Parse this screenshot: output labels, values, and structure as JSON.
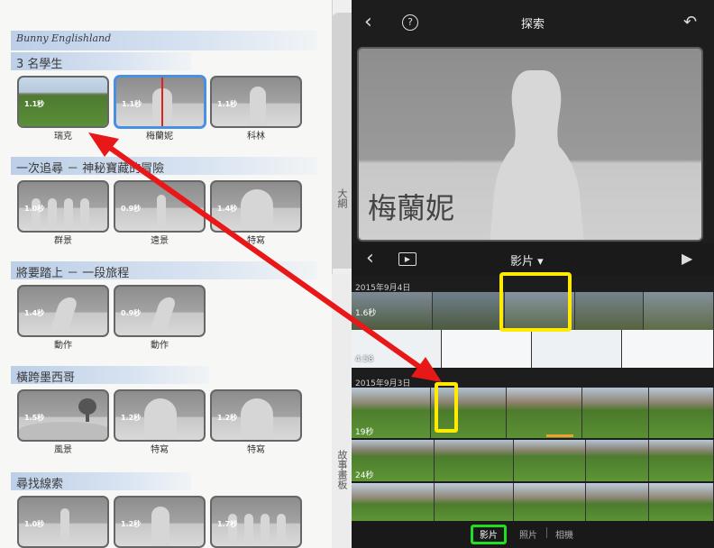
{
  "left_panel": {
    "project_title": "Bunny Englishland",
    "sections": [
      {
        "title": "3 名學生",
        "clips": [
          {
            "duration": "1.1秒",
            "caption": "瑞克",
            "kind": "field"
          },
          {
            "duration": "1.1秒",
            "caption": "梅蘭妮",
            "kind": "medium",
            "selected": true
          },
          {
            "duration": "1.1秒",
            "caption": "科林",
            "kind": "medium"
          }
        ]
      },
      {
        "title": "一次追尋 － 神秘寶藏的冒險",
        "clips": [
          {
            "duration": "1.0秒",
            "caption": "群景",
            "kind": "group"
          },
          {
            "duration": "0.9秒",
            "caption": "遠景",
            "kind": "wide"
          },
          {
            "duration": "1.4秒",
            "caption": "特寫",
            "kind": "closeup"
          }
        ]
      },
      {
        "title": "將要踏上 － 一段旅程",
        "clips": [
          {
            "duration": "1.4秒",
            "caption": "動作",
            "kind": "action"
          },
          {
            "duration": "0.9秒",
            "caption": "動作",
            "kind": "action"
          }
        ]
      },
      {
        "title": "橫跨墨西哥",
        "clips": [
          {
            "duration": "1.5秒",
            "caption": "風景",
            "kind": "landscape"
          },
          {
            "duration": "1.2秒",
            "caption": "特寫",
            "kind": "closeup"
          },
          {
            "duration": "1.2秒",
            "caption": "特寫",
            "kind": "closeup"
          }
        ]
      },
      {
        "title": "尋找線索",
        "clips": [
          {
            "duration": "1.0秒",
            "caption": "",
            "kind": "wide"
          },
          {
            "duration": "1.2秒",
            "caption": "",
            "kind": "medium"
          },
          {
            "duration": "1.7秒",
            "caption": "",
            "kind": "group"
          }
        ]
      }
    ]
  },
  "side_tabs": {
    "outline": "大綱",
    "storyboard": "故事畫板"
  },
  "right_panel": {
    "top_title": "探索",
    "preview_title": "梅蘭妮",
    "media_title": "影片",
    "groups": [
      {
        "date": "2015年9月4日",
        "strips": [
          {
            "duration": "1.6秒"
          },
          {
            "duration": "4:58"
          }
        ]
      },
      {
        "date": "2015年9月3日",
        "strips": [
          {
            "duration": "19秒"
          },
          {
            "duration": "24秒"
          },
          {
            "duration": ""
          }
        ]
      }
    ],
    "bottom_tabs": [
      "影片",
      "照片",
      "相機"
    ]
  },
  "colors": {
    "highlight_yellow": "#ffea00",
    "highlight_green": "#22dd22",
    "arrow_red": "#e81818",
    "selection_blue": "#4a90e2"
  }
}
